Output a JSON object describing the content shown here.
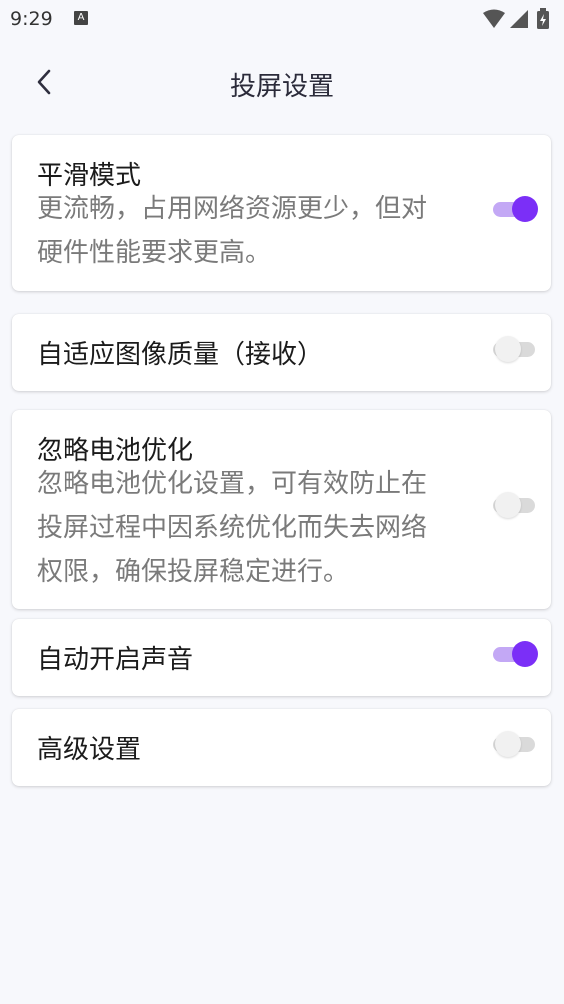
{
  "status_bar": {
    "time": "9:29",
    "notification_letter": "A"
  },
  "header": {
    "title": "投屏设置"
  },
  "settings": [
    {
      "title": "平滑模式",
      "desc_lines": [
        "更流畅，占用网络资源更少，但对",
        "硬件性能要求更高。"
      ],
      "enabled": true
    },
    {
      "title": "自适应图像质量（接收）",
      "desc_lines": [],
      "enabled": false
    },
    {
      "title": "忽略电池优化",
      "desc_lines": [
        "忽略电池优化设置，可有效防止在",
        "投屏过程中因系统优化而失去网络",
        "权限，确保投屏稳定进行。"
      ],
      "enabled": false
    },
    {
      "title": "自动开启声音",
      "desc_lines": [],
      "enabled": true
    },
    {
      "title": "高级设置",
      "desc_lines": [],
      "enabled": false
    }
  ],
  "colors": {
    "accent": "#7b2ff7",
    "accent_track": "#c3a8f5",
    "background": "#f7f8fc",
    "card": "#ffffff"
  },
  "icons": [
    "wifi-icon",
    "signal-icon",
    "battery-icon",
    "back-arrow-icon"
  ]
}
